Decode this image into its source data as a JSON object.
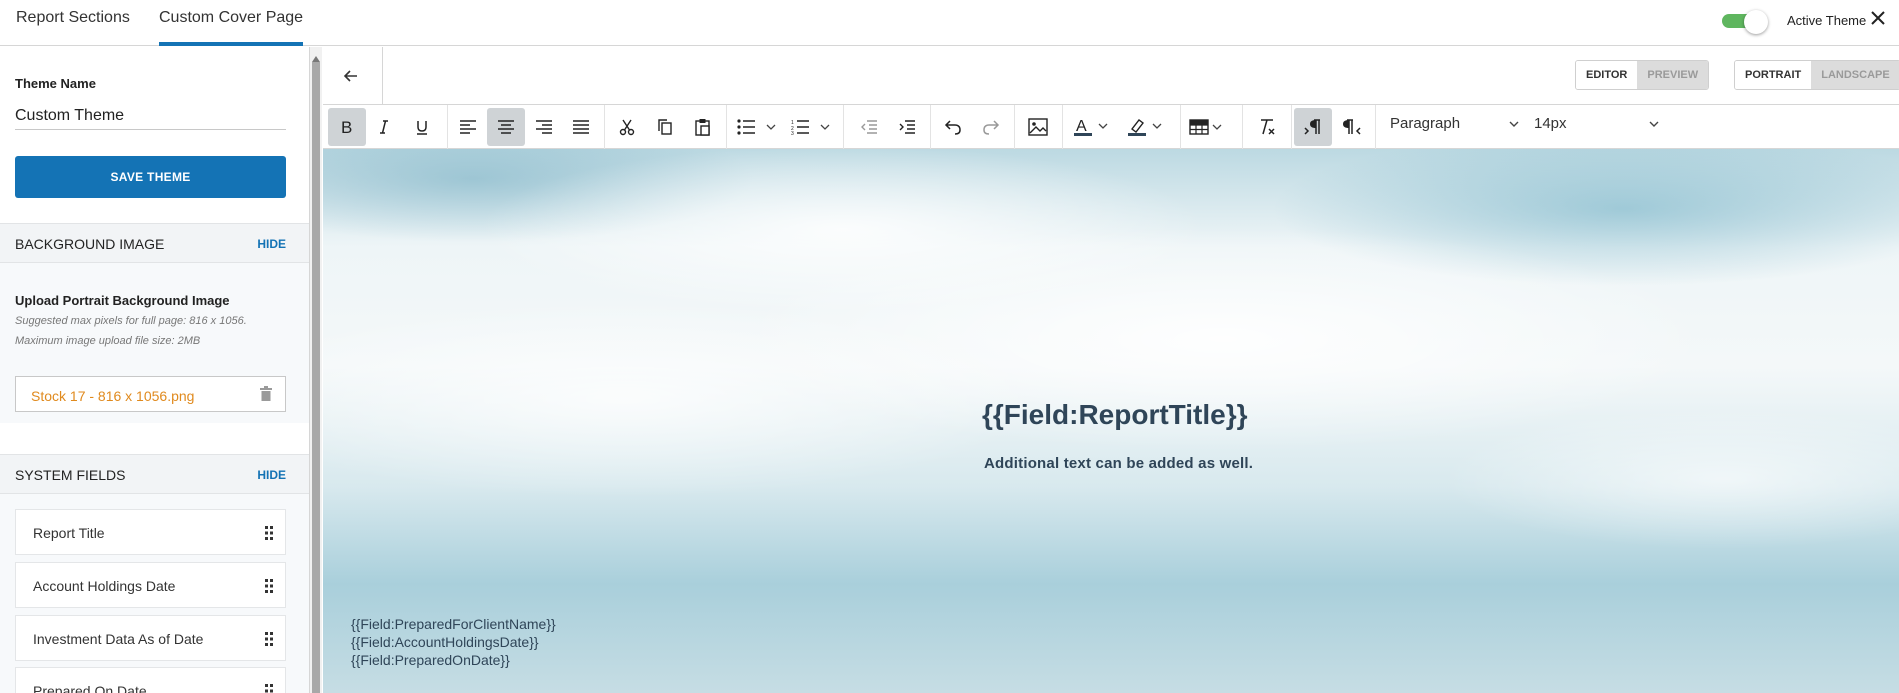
{
  "tabs": [
    {
      "label": "Report Sections"
    },
    {
      "label": "Custom Cover Page"
    }
  ],
  "active_theme": {
    "label": "Active Theme",
    "enabled": true
  },
  "left_panel": {
    "theme_name_label": "Theme Name",
    "theme_name_value": "Custom Theme",
    "save_button": "SAVE THEME",
    "background_image": {
      "title": "BACKGROUND IMAGE",
      "hide": "HIDE",
      "upload_title": "Upload Portrait Background Image",
      "hint1": "Suggested max pixels for full page: 816 x 1056.",
      "hint2": "Maximum image upload file size: 2MB",
      "file_name": "Stock 17 - 816 x 1056.png"
    },
    "system_fields": {
      "title": "SYSTEM FIELDS",
      "hide": "HIDE",
      "items": [
        {
          "label": "Report Title"
        },
        {
          "label": "Account Holdings Date"
        },
        {
          "label": "Investment Data As of Date"
        },
        {
          "label": "Prepared On Date"
        }
      ]
    }
  },
  "editor": {
    "mode": {
      "editor": "EDITOR",
      "preview": "PREVIEW",
      "selected": "EDITOR"
    },
    "orientation": {
      "portrait": "PORTRAIT",
      "landscape": "LANDSCAPE",
      "selected": "PORTRAIT"
    },
    "toolbar": {
      "block_format": "Paragraph",
      "font_size": "14px",
      "active_buttons": [
        "bold-icon",
        "align-center-icon",
        "ltr-icon"
      ]
    }
  },
  "canvas": {
    "title_field": "{{Field:ReportTitle}}",
    "subtitle": "Additional text can be added as well.",
    "footer_fields": [
      "{{Field:PreparedForClientName}}",
      "{{Field:AccountHoldingsDate}}",
      "{{Field:PreparedOnDate}}"
    ]
  },
  "colors": {
    "accent": "#1473b5",
    "file_name": "#e08a1e",
    "toggle_on": "#5fb65f",
    "canvas_text": "#2f4558"
  }
}
